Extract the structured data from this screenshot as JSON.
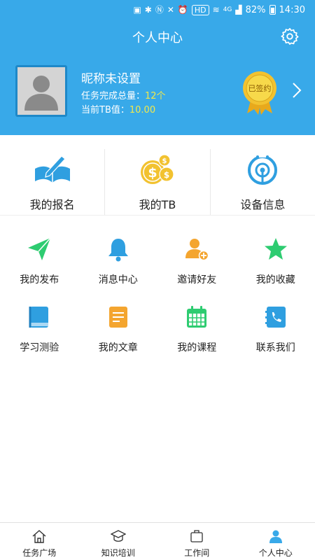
{
  "status_bar": {
    "hd_label": "HD",
    "network_label": "4G",
    "battery": "82%",
    "time": "14:30"
  },
  "header": {
    "title": "个人中心",
    "nickname": "昵称未设置",
    "task_total_label": "任务完成总量：",
    "task_total_value": "12个",
    "tb_label": "当前TB值：",
    "tb_value": "10.00",
    "signed_badge": "已签约"
  },
  "main_items": [
    {
      "label": "我的报名",
      "icon": "book-pencil-icon"
    },
    {
      "label": "我的TB",
      "icon": "coins-icon"
    },
    {
      "label": "设备信息",
      "icon": "device-signal-icon"
    }
  ],
  "grid_items": [
    {
      "label": "我的发布",
      "icon": "paper-plane-icon"
    },
    {
      "label": "消息中心",
      "icon": "bell-icon"
    },
    {
      "label": "邀请好友",
      "icon": "add-friend-icon"
    },
    {
      "label": "我的收藏",
      "icon": "star-icon"
    },
    {
      "label": "学习测验",
      "icon": "notebook-icon"
    },
    {
      "label": "我的文章",
      "icon": "document-icon"
    },
    {
      "label": "我的课程",
      "icon": "calendar-icon"
    },
    {
      "label": "联系我们",
      "icon": "phone-book-icon"
    }
  ],
  "tabbar": [
    {
      "label": "任务广场",
      "icon": "home-icon"
    },
    {
      "label": "知识培训",
      "icon": "graduation-cap-icon"
    },
    {
      "label": "工作间",
      "icon": "workspace-icon"
    },
    {
      "label": "个人中心",
      "icon": "person-icon"
    }
  ],
  "colors": {
    "primary": "#38a9e9",
    "accent_yellow": "#f3e94a",
    "gold": "#f2c230",
    "green": "#2ecc71",
    "orange": "#f4a52f"
  }
}
